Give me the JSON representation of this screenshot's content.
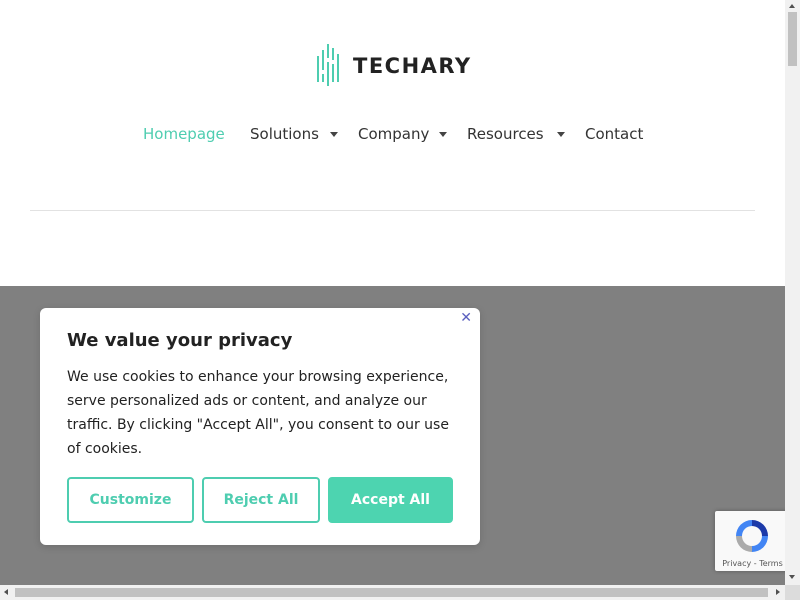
{
  "brand": {
    "name": "TECHARY",
    "accent": "#4ecdb0"
  },
  "nav": {
    "items": [
      {
        "label": "Homepage",
        "active": true,
        "dropdown": false
      },
      {
        "label": "Solutions",
        "active": false,
        "dropdown": true
      },
      {
        "label": "Company",
        "active": false,
        "dropdown": true
      },
      {
        "label": "Resources",
        "active": false,
        "dropdown": true
      },
      {
        "label": "Contact",
        "active": false,
        "dropdown": false
      }
    ]
  },
  "cookie": {
    "title": "We value your privacy",
    "body": "We use cookies to enhance your browsing experience, serve personalized ads or content, and analyze our traffic. By clicking \"Accept All\", you consent to our use of cookies.",
    "close_symbol": "✕",
    "customize_label": "Customize",
    "reject_label": "Reject All",
    "accept_label": "Accept All"
  },
  "recaptcha": {
    "links": "Privacy - Terms"
  },
  "colors": {
    "overlay": "#808080",
    "button_fill": "#4dd4b0"
  }
}
